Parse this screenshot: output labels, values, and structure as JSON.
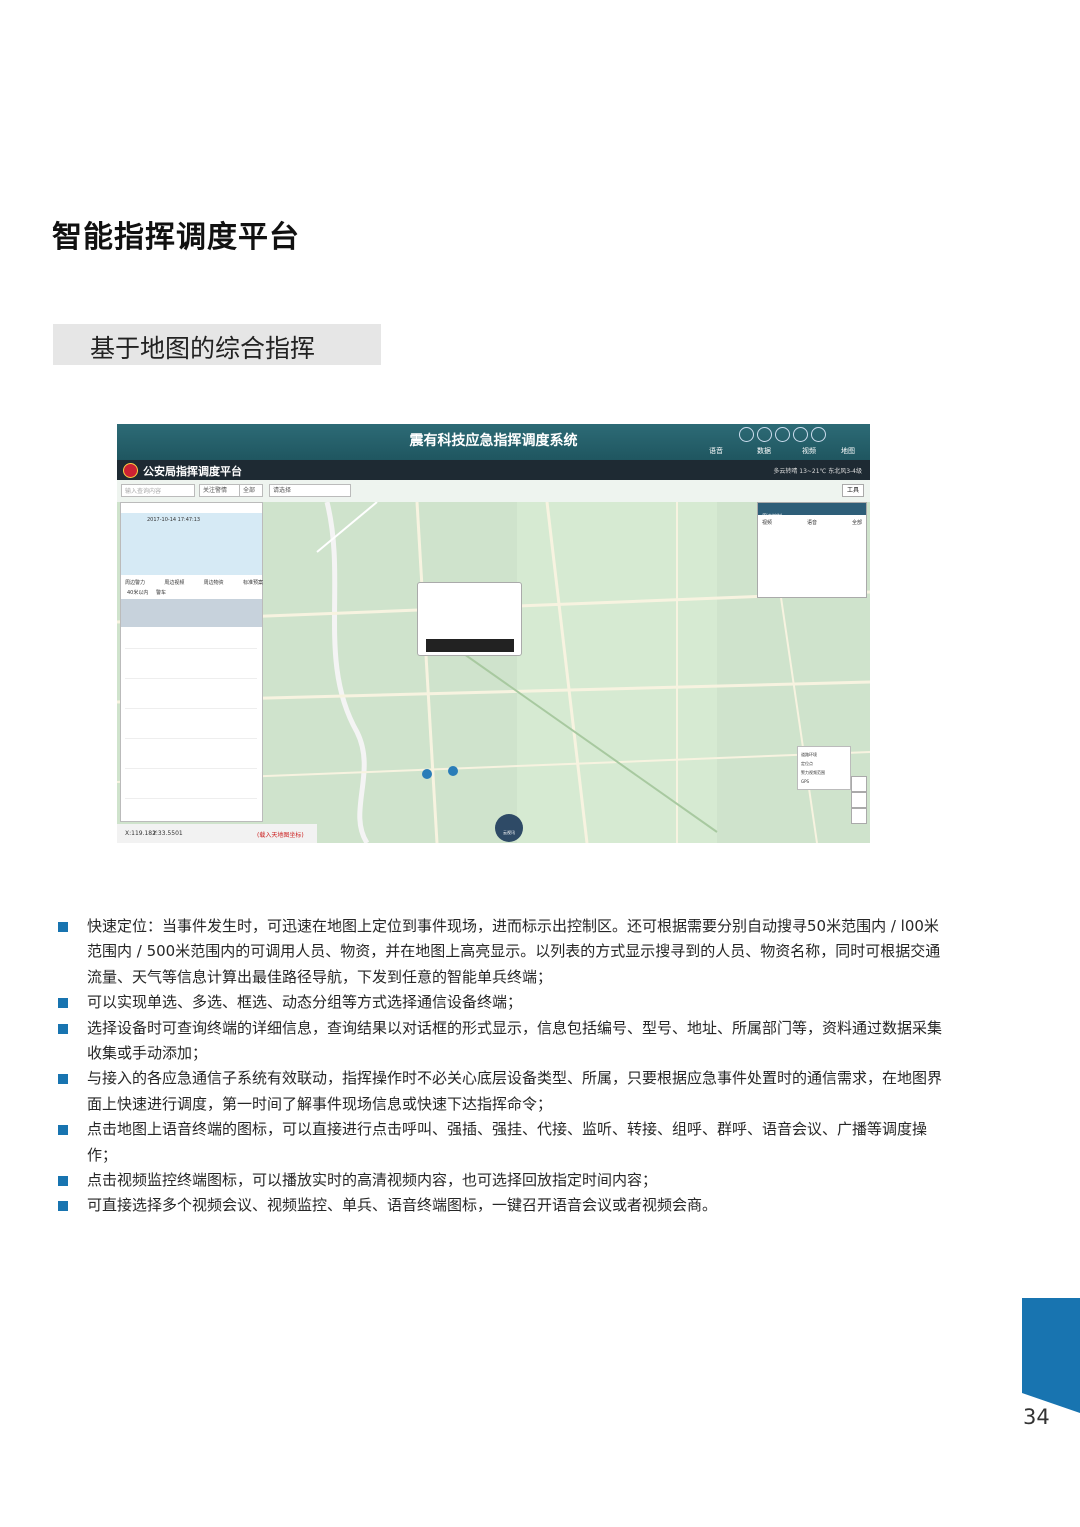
{
  "page": {
    "title": "智能指挥调度平台",
    "section": "基于地图的综合指挥",
    "page_number": "34"
  },
  "screenshot": {
    "system_title": "震有科技应急指挥调度系统",
    "platform_title": "公安局指挥调度平台",
    "nav_tabs": [
      "语音",
      "数据",
      "视频",
      "地图"
    ],
    "weather": "多云转晴 13~21℃ 东北风3-4级",
    "search_placeholder": "输入查询内容",
    "select_1": "关注警情",
    "select_2": "全部",
    "select_3": "请选择",
    "tools_label": "工具",
    "event_time": "2017-10-14 17:47:13",
    "tab_labels": [
      "周边警力",
      "周边视频",
      "周边物资",
      "标准预案"
    ],
    "radius_options": [
      "40米以内",
      "警车"
    ],
    "coord_x": "X:119.182",
    "coord_y": "Y:33.5501",
    "coord_hint": "(载入天地图坐标)",
    "control_panel_title": "周边控制",
    "control_items": [
      "视频",
      "语音",
      "全部"
    ],
    "layer_items": [
      "道路环境",
      "定位点",
      "警力视频范围",
      "GPS"
    ],
    "cloud_label": "云视讯"
  },
  "bullets": [
    "快速定位：当事件发生时，可迅速在地图上定位到事件现场，进而标示出控制区。还可根据需要分别自动搜寻50米范围内 / l00米范围内 / 500米范围内的可调用人员、物资，并在地图上高亮显示。以列表的方式显示搜寻到的人员、物资名称，同时可根据交通流量、天气等信息计算出最佳路径导航，下发到任意的智能单兵终端；",
    "可以实现单选、多选、框选、动态分组等方式选择通信设备终端；",
    "选择设备时可查询终端的详细信息，查询结果以对话框的形式显示，信息包括编号、型号、地址、所属部门等，资料通过数据采集收集或手动添加；",
    "与接入的各应急通信子系统有效联动，指挥操作时不必关心底层设备类型、所属，只要根据应急事件处置时的通信需求，在地图界面上快速进行调度，第一时间了解事件现场信息或快速下达指挥命令；",
    "点击地图上语音终端的图标，可以直接进行点击呼叫、强插、强挂、代接、监听、转接、组呼、群呼、语音会议、广播等调度操作；",
    "点击视频监控终端图标，可以播放实时的高清视频内容，也可选择回放指定时间内容；",
    "可直接选择多个视频会议、视频监控、单兵、语音终端图标，一键召开语音会议或者视频会商。"
  ],
  "colors": {
    "accent_blue": "#1874b0",
    "banner_gray": "#e6e6e6",
    "map_green": "#cfe3cc"
  }
}
